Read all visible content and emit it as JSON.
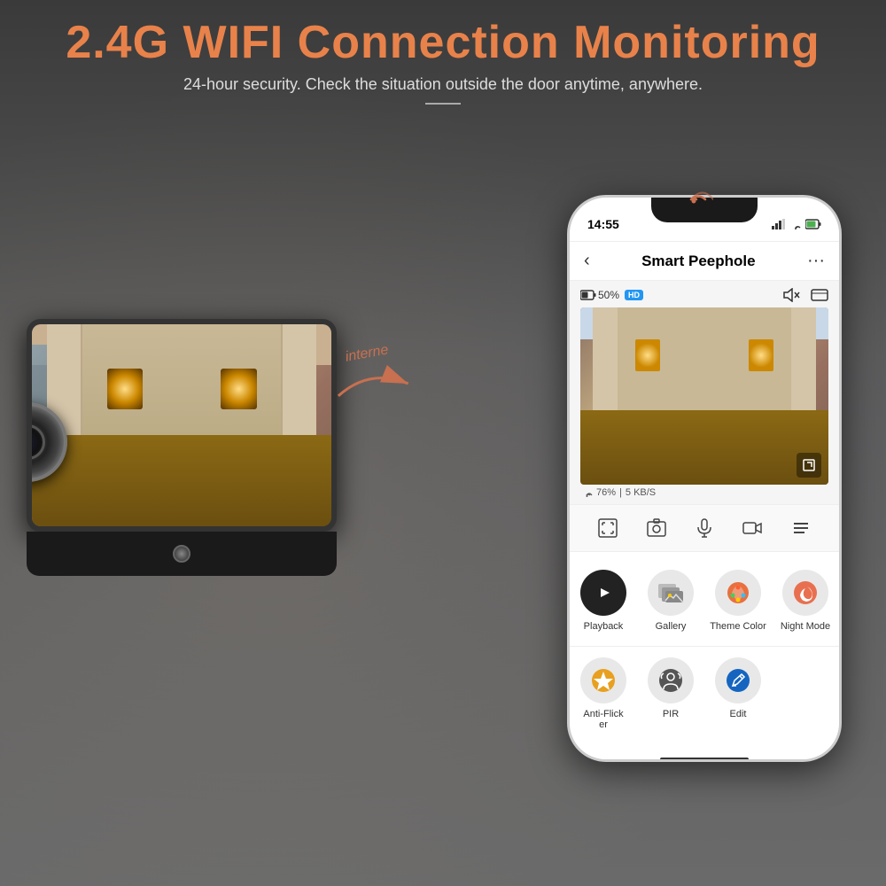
{
  "header": {
    "title": "2.4G WIFI Connection Monitoring",
    "subtitle": "24-hour security. Check the situation outside the door anytime, anywhere.",
    "divider": "——"
  },
  "arrow": {
    "label": "interne"
  },
  "phone": {
    "time": "14:55",
    "app_title": "Smart Peephole",
    "back_icon": "‹",
    "more_icon": "···",
    "battery_pct": "50%",
    "quality_badge": "HD",
    "wifi_pct": "76%",
    "speed": "5 KB/S",
    "controls": [
      "⊡",
      "📷",
      "🎤",
      "▶",
      "≡"
    ],
    "app_items": [
      {
        "label": "Playback",
        "color": "#222"
      },
      {
        "label": "Gallery",
        "color": "#222"
      },
      {
        "label": "Theme Color",
        "color": "#222"
      },
      {
        "label": "Night Mode",
        "color": "#e05020"
      }
    ],
    "app_items2": [
      {
        "label": "Anti-Flicker",
        "color": "#e0a020"
      },
      {
        "label": "PIR",
        "color": "#555"
      },
      {
        "label": "Edit",
        "color": "#1565C0"
      }
    ]
  },
  "colors": {
    "title_orange": "#e8824a",
    "bg_dark": "#3d3d3d",
    "playback_bg": "#222",
    "gallery_bg": "#888",
    "theme_bg": "#e87040",
    "nightmode_bg": "#e05020",
    "antiflicker_bg": "#e0a020",
    "pir_bg": "#555",
    "edit_bg": "#1565C0"
  }
}
